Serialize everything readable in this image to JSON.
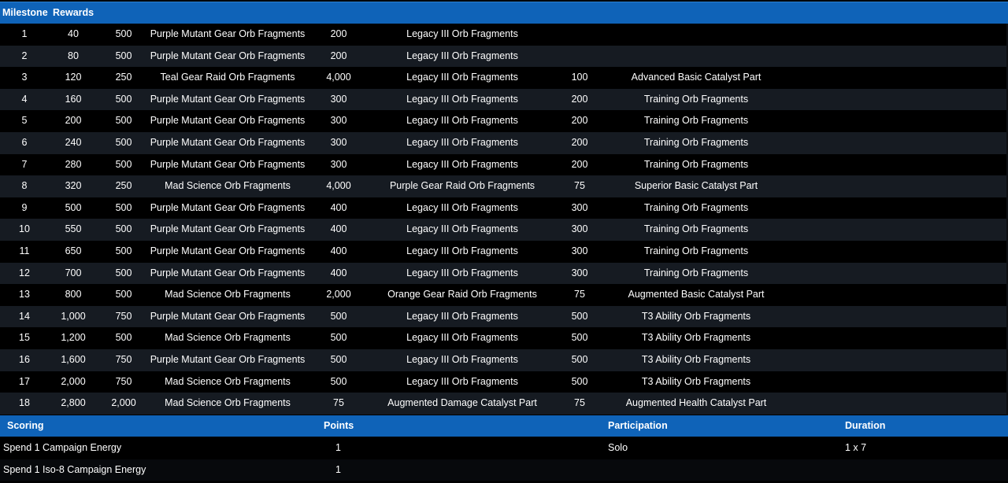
{
  "milestones": {
    "header": {
      "col_milestone": "Milestone",
      "col_rewards": "Rewards"
    },
    "rows": [
      {
        "n": "1",
        "points": "40",
        "r1": "500",
        "r1_item": "Purple Mutant Gear Orb Fragments",
        "r2": "200",
        "r2_item": "Legacy III Orb Fragments",
        "r3": "",
        "r3_item": ""
      },
      {
        "n": "2",
        "points": "80",
        "r1": "500",
        "r1_item": "Purple Mutant Gear Orb Fragments",
        "r2": "200",
        "r2_item": "Legacy III Orb Fragments",
        "r3": "",
        "r3_item": ""
      },
      {
        "n": "3",
        "points": "120",
        "r1": "250",
        "r1_item": "Teal Gear Raid Orb Fragments",
        "r2": "4,000",
        "r2_item": "Legacy III Orb Fragments",
        "r3": "100",
        "r3_item": "Advanced Basic Catalyst Part"
      },
      {
        "n": "4",
        "points": "160",
        "r1": "500",
        "r1_item": "Purple Mutant Gear Orb Fragments",
        "r2": "300",
        "r2_item": "Legacy III Orb Fragments",
        "r3": "200",
        "r3_item": "Training Orb Fragments"
      },
      {
        "n": "5",
        "points": "200",
        "r1": "500",
        "r1_item": "Purple Mutant Gear Orb Fragments",
        "r2": "300",
        "r2_item": "Legacy III Orb Fragments",
        "r3": "200",
        "r3_item": "Training Orb Fragments"
      },
      {
        "n": "6",
        "points": "240",
        "r1": "500",
        "r1_item": "Purple Mutant Gear Orb Fragments",
        "r2": "300",
        "r2_item": "Legacy III Orb Fragments",
        "r3": "200",
        "r3_item": "Training Orb Fragments"
      },
      {
        "n": "7",
        "points": "280",
        "r1": "500",
        "r1_item": "Purple Mutant Gear Orb Fragments",
        "r2": "300",
        "r2_item": "Legacy III Orb Fragments",
        "r3": "200",
        "r3_item": "Training Orb Fragments"
      },
      {
        "n": "8",
        "points": "320",
        "r1": "250",
        "r1_item": "Mad Science Orb Fragments",
        "r2": "4,000",
        "r2_item": "Purple Gear Raid Orb Fragments",
        "r3": "75",
        "r3_item": "Superior Basic Catalyst Part"
      },
      {
        "n": "9",
        "points": "500",
        "r1": "500",
        "r1_item": "Purple Mutant Gear Orb Fragments",
        "r2": "400",
        "r2_item": "Legacy III Orb Fragments",
        "r3": "300",
        "r3_item": "Training Orb Fragments"
      },
      {
        "n": "10",
        "points": "550",
        "r1": "500",
        "r1_item": "Purple Mutant Gear Orb Fragments",
        "r2": "400",
        "r2_item": "Legacy III Orb Fragments",
        "r3": "300",
        "r3_item": "Training Orb Fragments"
      },
      {
        "n": "11",
        "points": "650",
        "r1": "500",
        "r1_item": "Purple Mutant Gear Orb Fragments",
        "r2": "400",
        "r2_item": "Legacy III Orb Fragments",
        "r3": "300",
        "r3_item": "Training Orb Fragments"
      },
      {
        "n": "12",
        "points": "700",
        "r1": "500",
        "r1_item": "Purple Mutant Gear Orb Fragments",
        "r2": "400",
        "r2_item": "Legacy III Orb Fragments",
        "r3": "300",
        "r3_item": "Training Orb Fragments"
      },
      {
        "n": "13",
        "points": "800",
        "r1": "500",
        "r1_item": "Mad Science Orb Fragments",
        "r2": "2,000",
        "r2_item": "Orange Gear Raid Orb Fragments",
        "r3": "75",
        "r3_item": "Augmented Basic Catalyst Part"
      },
      {
        "n": "14",
        "points": "1,000",
        "r1": "750",
        "r1_item": "Purple Mutant Gear Orb Fragments",
        "r2": "500",
        "r2_item": "Legacy III Orb Fragments",
        "r3": "500",
        "r3_item": "T3 Ability Orb Fragments"
      },
      {
        "n": "15",
        "points": "1,200",
        "r1": "500",
        "r1_item": "Mad Science Orb Fragments",
        "r2": "500",
        "r2_item": "Legacy III Orb Fragments",
        "r3": "500",
        "r3_item": "T3 Ability Orb Fragments"
      },
      {
        "n": "16",
        "points": "1,600",
        "r1": "750",
        "r1_item": "Purple Mutant Gear Orb Fragments",
        "r2": "500",
        "r2_item": "Legacy III Orb Fragments",
        "r3": "500",
        "r3_item": "T3 Ability Orb Fragments"
      },
      {
        "n": "17",
        "points": "2,000",
        "r1": "750",
        "r1_item": "Mad Science Orb Fragments",
        "r2": "500",
        "r2_item": "Legacy III Orb Fragments",
        "r3": "500",
        "r3_item": "T3 Ability Orb Fragments"
      },
      {
        "n": "18",
        "points": "2,800",
        "r1": "2,000",
        "r1_item": "Mad Science Orb Fragments",
        "r2": "75",
        "r2_item": "Augmented Damage Catalyst Part",
        "r3": "75",
        "r3_item": "Augmented Health Catalyst Part"
      }
    ]
  },
  "scoring": {
    "header": {
      "col_scoring": "Scoring",
      "col_points": "Points",
      "col_participation": "Participation",
      "col_duration": "Duration"
    },
    "rows": [
      {
        "action": "Spend 1 Campaign Energy",
        "points": "1",
        "participation": "Solo",
        "duration": "1 x 7"
      },
      {
        "action": "Spend 1 Iso-8 Campaign Energy",
        "points": "1",
        "participation": "",
        "duration": ""
      }
    ]
  },
  "colors": {
    "header_bg": "#0f63b8",
    "row_alt_bg": "#161b22",
    "row_bg": "#000000",
    "text": "#ffffff"
  }
}
